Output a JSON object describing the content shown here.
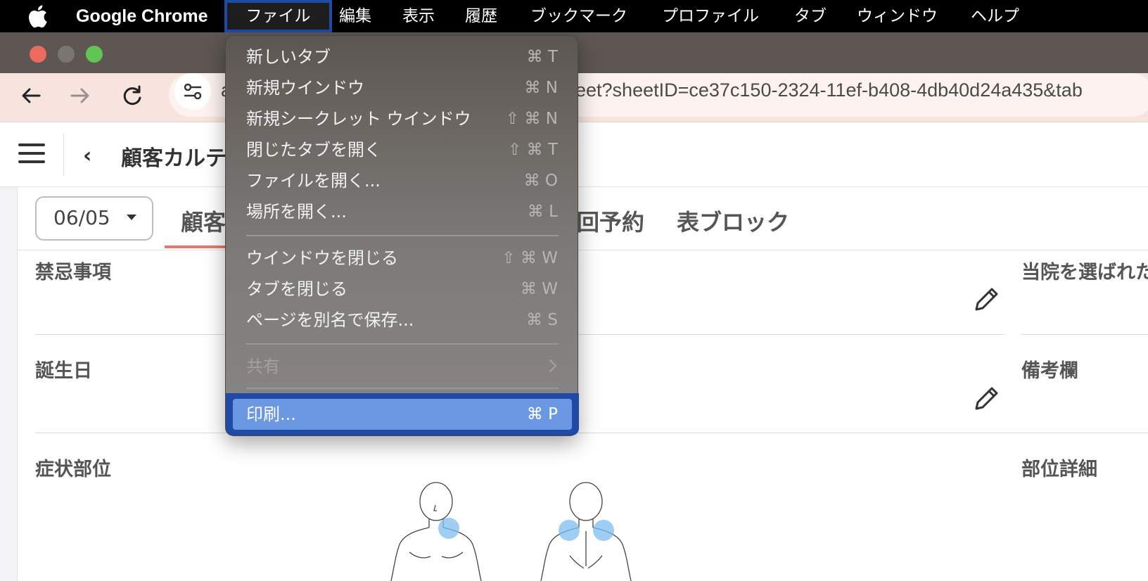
{
  "menubar": {
    "app_name": "Google Chrome",
    "items": [
      "ファイル",
      "編集",
      "表示",
      "履歴",
      "ブックマーク",
      "プロファイル",
      "タブ",
      "ウィンドウ",
      "ヘルプ"
    ]
  },
  "browser": {
    "url_visible_prefix": "a",
    "url_visible_suffix": "eet?sheetID=ce37c150-2324-11ef-b408-4db40d24a435&tab"
  },
  "app": {
    "page_title": "顧客カルテ",
    "date_value": "06/05",
    "tabs": [
      "顧客",
      "回予約",
      "表ブロック"
    ],
    "fields": {
      "contraindications": "禁忌事項",
      "birthday": "誕生日",
      "symptom_area": "症状部位",
      "reason_chosen": "当院を選ばれた",
      "remarks": "備考欄",
      "area_detail": "部位詳細"
    }
  },
  "file_menu": {
    "items": [
      {
        "label": "新しいタブ",
        "shortcut": "⌘ T"
      },
      {
        "label": "新規ウインドウ",
        "shortcut": "⌘ N"
      },
      {
        "label": "新規シークレット ウインドウ",
        "shortcut": "⇧ ⌘ N"
      },
      {
        "label": "閉じたタブを開く",
        "shortcut": "⇧ ⌘ T"
      },
      {
        "label": "ファイルを開く...",
        "shortcut": "⌘ O"
      },
      {
        "label": "場所を開く...",
        "shortcut": "⌘ L"
      },
      {
        "label": "ウインドウを閉じる",
        "shortcut": "⇧ ⌘ W"
      },
      {
        "label": "タブを閉じる",
        "shortcut": "⌘ W"
      },
      {
        "label": "ページを別名で保存...",
        "shortcut": "⌘ S"
      },
      {
        "label": "共有",
        "shortcut": ""
      },
      {
        "label": "印刷...",
        "shortcut": "⌘ P"
      }
    ]
  },
  "colors": {
    "menu_highlight_border": "#1f4aa6",
    "menu_highlight_fill": "#6a98e3",
    "tab_active_underline": "#e8796b",
    "symptom_marker": "#7fbdf2"
  }
}
